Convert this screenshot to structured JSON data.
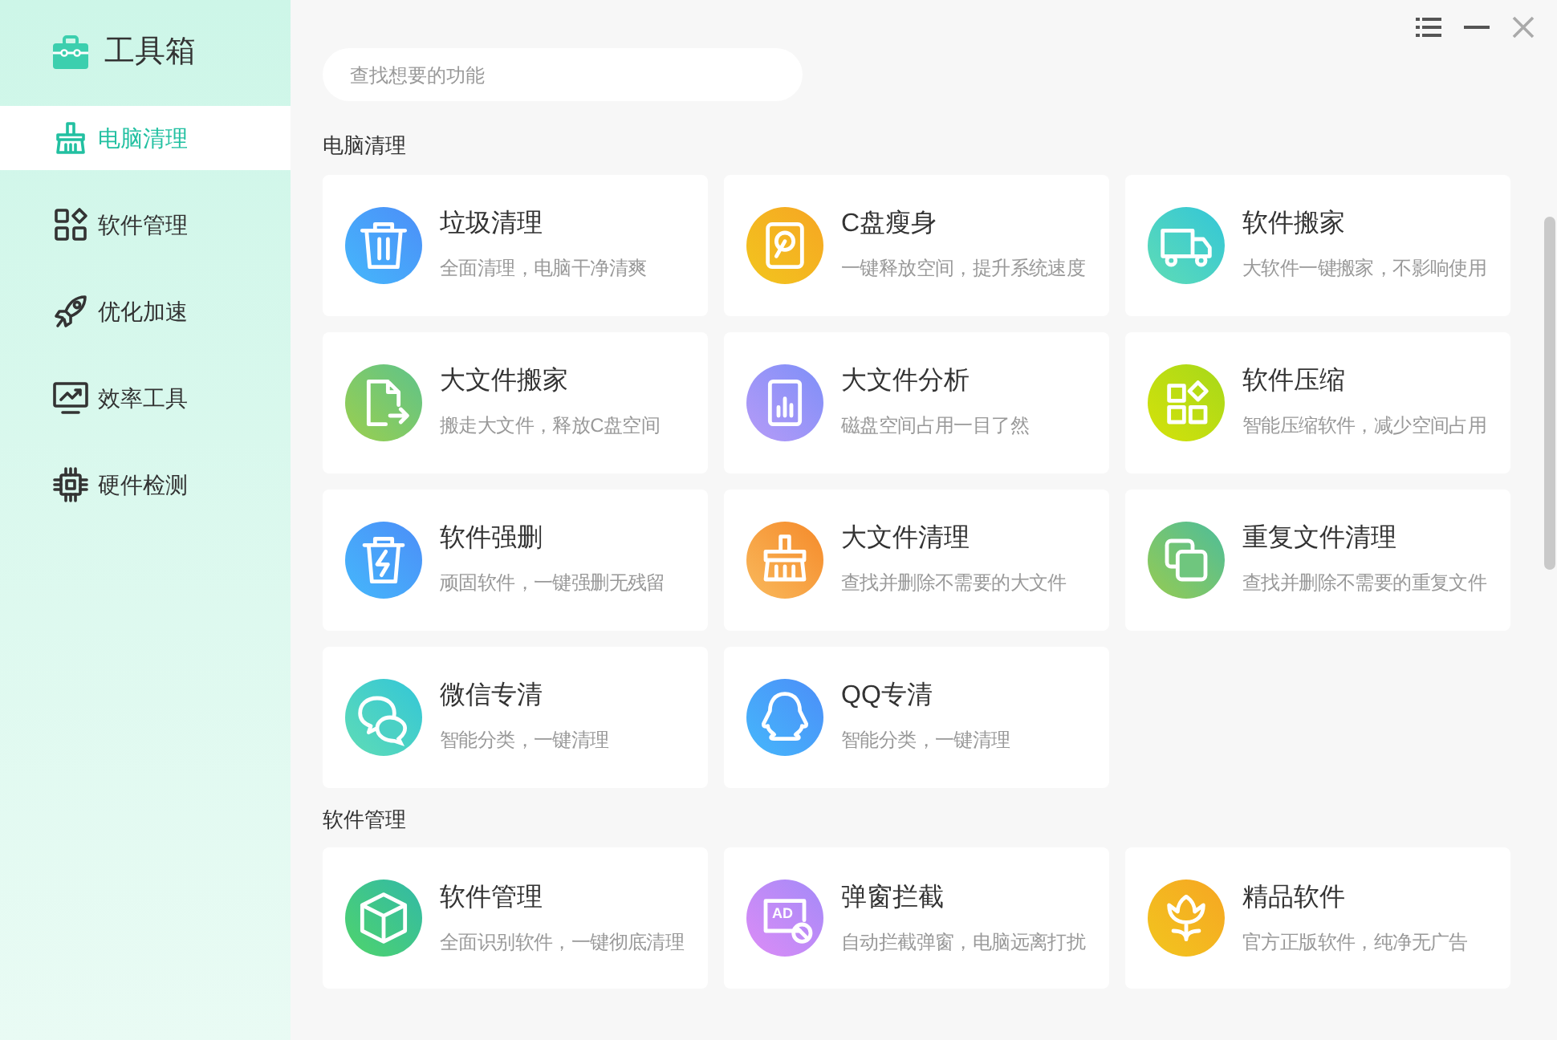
{
  "app": {
    "title": "工具箱"
  },
  "sidebar": {
    "items": [
      {
        "label": "电脑清理",
        "kind": "broom",
        "selected": true
      },
      {
        "label": "软件管理",
        "kind": "apps",
        "selected": false
      },
      {
        "label": "优化加速",
        "kind": "rocket",
        "selected": false
      },
      {
        "label": "效率工具",
        "kind": "monitor",
        "selected": false
      },
      {
        "label": "硬件检测",
        "kind": "chip",
        "selected": false
      }
    ]
  },
  "search": {
    "placeholder": "查找想要的功能"
  },
  "sections": [
    {
      "title": "电脑清理",
      "cards": [
        {
          "title": "垃圾清理",
          "subtitle": "全面清理，电脑干净清爽",
          "kind": "trash"
        },
        {
          "title": "C盘瘦身",
          "subtitle": "一键释放空间，提升系统速度",
          "kind": "disk"
        },
        {
          "title": "软件搬家",
          "subtitle": "大软件一键搬家，不影响使用",
          "kind": "truck"
        },
        {
          "title": "大文件搬家",
          "subtitle": "搬走大文件，释放C盘空间",
          "kind": "file-move"
        },
        {
          "title": "大文件分析",
          "subtitle": "磁盘空间占用一目了然",
          "kind": "chart"
        },
        {
          "title": "软件压缩",
          "subtitle": "智能压缩软件，减少空间占用",
          "kind": "apps"
        },
        {
          "title": "软件强删",
          "subtitle": "顽固软件，一键强删无残留",
          "kind": "force"
        },
        {
          "title": "大文件清理",
          "subtitle": "查找并删除不需要的大文件",
          "kind": "broom"
        },
        {
          "title": "重复文件清理",
          "subtitle": "查找并删除不需要的重复文件",
          "kind": "copy"
        },
        {
          "title": "微信专清",
          "subtitle": "智能分类，一键清理",
          "kind": "chat"
        },
        {
          "title": "QQ专清",
          "subtitle": "智能分类，一键清理",
          "kind": "penguin"
        }
      ]
    },
    {
      "title": "软件管理",
      "cards": [
        {
          "title": "软件管理",
          "subtitle": "全面识别软件，一键彻底清理",
          "kind": "box"
        },
        {
          "title": "弹窗拦截",
          "subtitle": "自动拦截弹窗，电脑远离打扰",
          "kind": "ad",
          "icon_text": "AD"
        },
        {
          "title": "精品软件",
          "subtitle": "官方正版软件，纯净无广告",
          "kind": "flower"
        }
      ]
    }
  ]
}
